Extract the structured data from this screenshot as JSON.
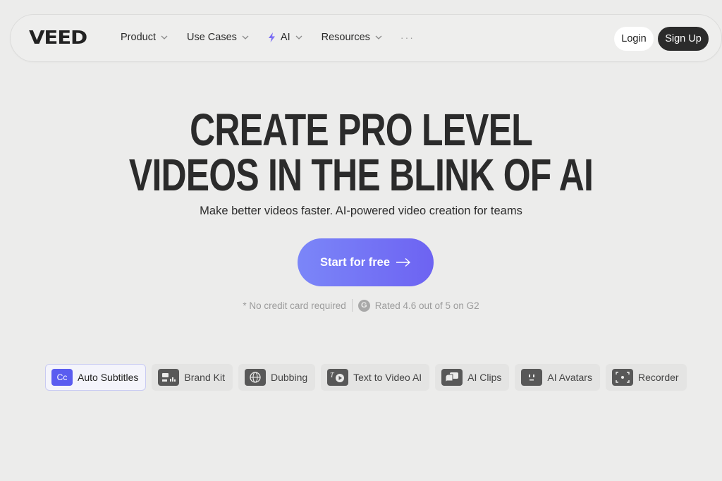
{
  "brand": {
    "logo_text": "VEED"
  },
  "nav": {
    "items": [
      {
        "label": "Product",
        "has_dropdown": true
      },
      {
        "label": "Use Cases",
        "has_dropdown": true
      },
      {
        "label": "AI",
        "has_dropdown": true,
        "icon": "lightning-bolt-icon"
      },
      {
        "label": "Resources",
        "has_dropdown": true
      }
    ],
    "more_label": "···",
    "login_label": "Login",
    "signup_label": "Sign Up"
  },
  "hero": {
    "headline_line1": "CREATE PRO LEVEL",
    "headline_line2": "VIDEOS IN THE BLINK OF AI",
    "subheadline": "Make better videos faster. AI-powered video creation for teams",
    "cta_label": "Start for free",
    "no_card_text": "* No credit card required",
    "rating_icon_text": "G",
    "rating_text": "Rated 4.6 out of 5 on G2"
  },
  "feature_tabs": [
    {
      "label": "Auto Subtitles",
      "icon": "cc-icon",
      "icon_text": "Cc",
      "active": true
    },
    {
      "label": "Brand Kit",
      "icon": "brand-kit-icon",
      "icon_text": "",
      "active": false
    },
    {
      "label": "Dubbing",
      "icon": "globe-icon",
      "icon_text": "",
      "active": false
    },
    {
      "label": "Text to Video AI",
      "icon": "text-to-video-icon",
      "icon_text": "",
      "active": false
    },
    {
      "label": "AI Clips",
      "icon": "ai-clips-icon",
      "icon_text": "",
      "active": false
    },
    {
      "label": "AI Avatars",
      "icon": "avatar-icon",
      "icon_text": "",
      "active": false
    },
    {
      "label": "Recorder",
      "icon": "recorder-icon",
      "icon_text": "",
      "active": false
    }
  ],
  "colors": {
    "background": "#ececeb",
    "cta_start": "#7b86f8",
    "cta_end": "#6d63f2",
    "active_tab_icon": "#5a5cf0",
    "dark_button": "#2b2b2b",
    "ai_bolt": "#7a6cf5"
  }
}
